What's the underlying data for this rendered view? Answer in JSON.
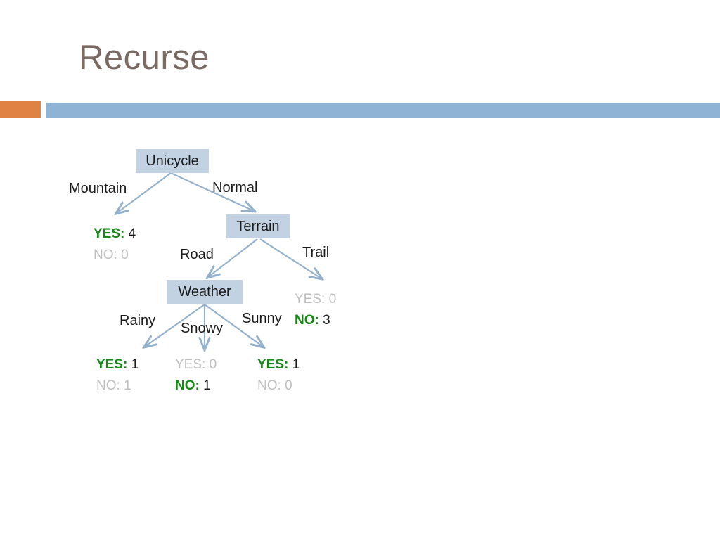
{
  "slide": {
    "title": "Recurse",
    "title_color": "#7a6a63",
    "accent_orange": "#df8244",
    "accent_blue": "#8fb3d4"
  },
  "diagram": {
    "node_fill": "#c2d2e2",
    "arrow_color": "#93b0cc",
    "win_color": "#148a14",
    "lose_color": "#bfbfbf",
    "nodes": [
      {
        "id": "unicycle",
        "label": "Unicycle"
      },
      {
        "id": "terrain",
        "label": "Terrain"
      },
      {
        "id": "weather",
        "label": "Weather"
      }
    ],
    "edges": [
      {
        "id": "mountain",
        "label": "Mountain"
      },
      {
        "id": "normal",
        "label": "Normal"
      },
      {
        "id": "road",
        "label": "Road"
      },
      {
        "id": "trail",
        "label": "Trail"
      },
      {
        "id": "rainy",
        "label": "Rainy"
      },
      {
        "id": "snowy",
        "label": "Snowy"
      },
      {
        "id": "sunny",
        "label": "Sunny"
      }
    ],
    "leaves": [
      {
        "id": "mountain",
        "yes_label": "YES:",
        "yes_count": "4",
        "no_label": "NO:",
        "no_count": "0",
        "winner": "yes"
      },
      {
        "id": "trail",
        "yes_label": "YES:",
        "yes_count": "0",
        "no_label": "NO:",
        "no_count": "3",
        "winner": "no"
      },
      {
        "id": "rainy",
        "yes_label": "YES:",
        "yes_count": "1",
        "no_label": "NO:",
        "no_count": "1",
        "winner": "yes"
      },
      {
        "id": "snowy",
        "yes_label": "YES:",
        "yes_count": "0",
        "no_label": "NO:",
        "no_count": "1",
        "winner": "no"
      },
      {
        "id": "sunny",
        "yes_label": "YES:",
        "yes_count": "1",
        "no_label": "NO:",
        "no_count": "0",
        "winner": "yes"
      }
    ]
  }
}
